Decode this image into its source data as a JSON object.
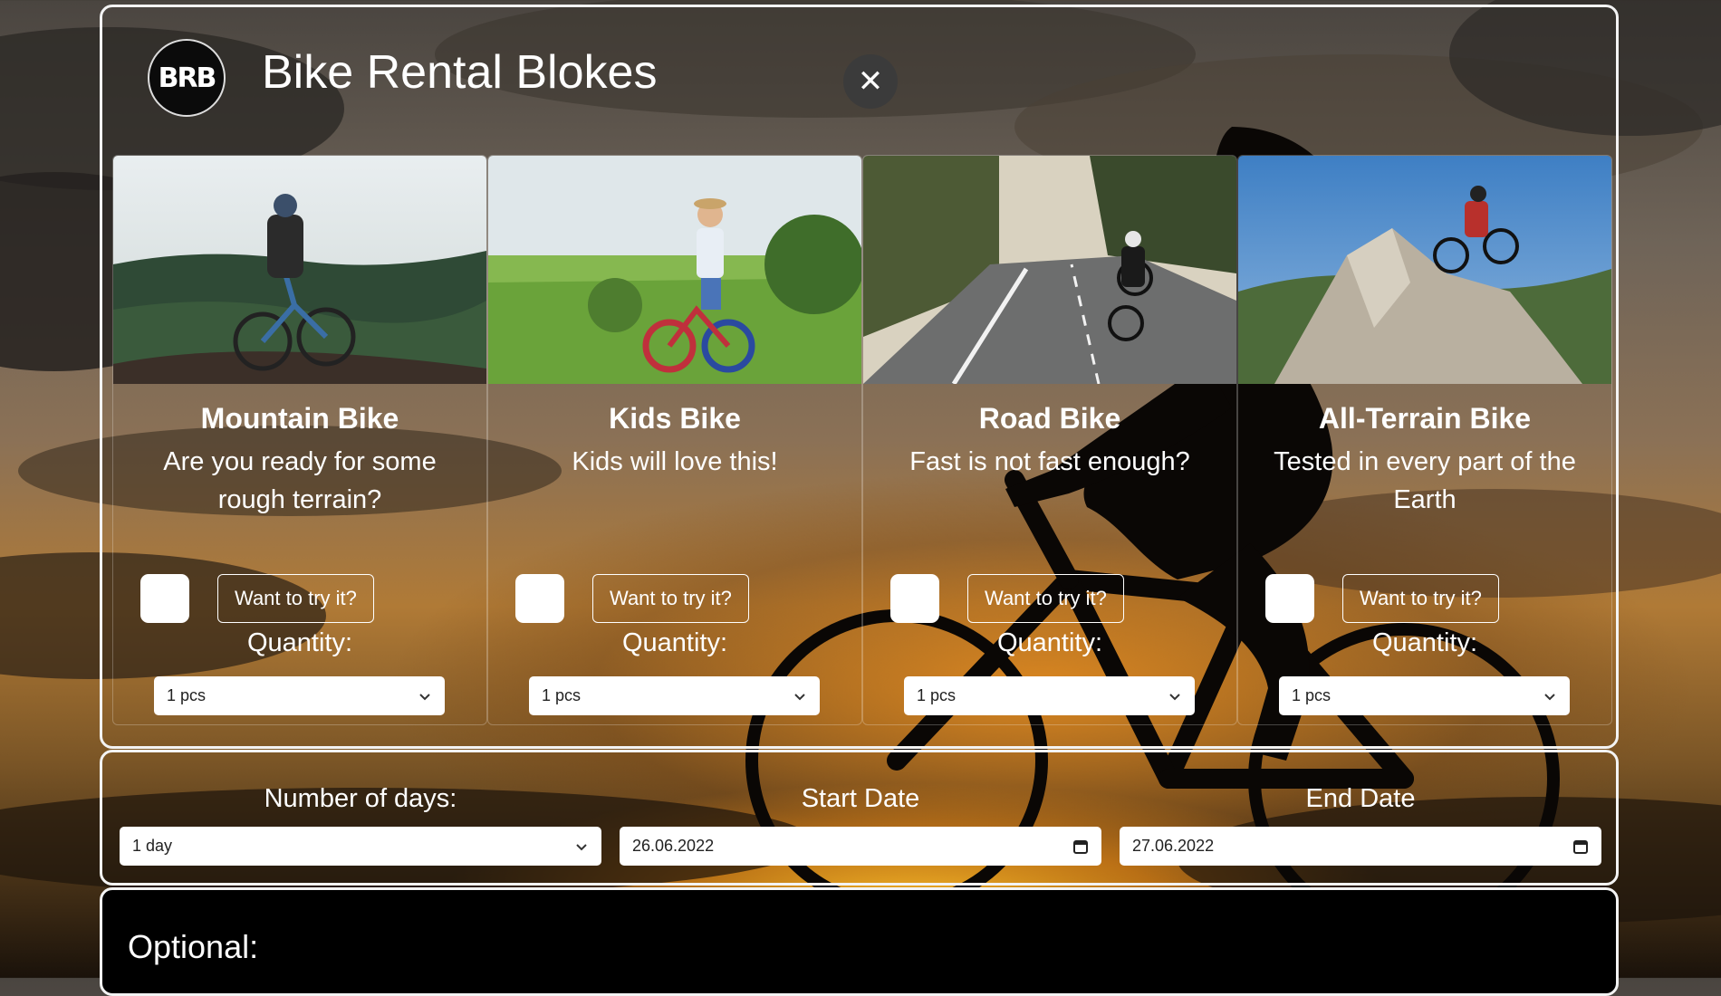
{
  "app": {
    "logo_text": "BRB",
    "title": "Bike Rental Blokes",
    "close_icon": "close-icon"
  },
  "bikes": [
    {
      "title": "Mountain Bike",
      "description": "Are you ready for some rough terrain?",
      "button": "Want to try it?",
      "quantity_label": "Quantity:",
      "quantity_value": "1 pcs"
    },
    {
      "title": "Kids Bike",
      "description": "Kids will love this!",
      "button": "Want to try it?",
      "quantity_label": "Quantity:",
      "quantity_value": "1 pcs"
    },
    {
      "title": "Road Bike",
      "description": "Fast is not fast enough?",
      "button": "Want to try it?",
      "quantity_label": "Quantity:",
      "quantity_value": "1 pcs"
    },
    {
      "title": "All-Terrain Bike",
      "description": "Tested in every part of the Earth",
      "button": "Want to try it?",
      "quantity_label": "Quantity:",
      "quantity_value": "1 pcs"
    }
  ],
  "booking": {
    "days_label": "Number of days:",
    "days_value": "1 day",
    "start_label": "Start Date",
    "start_value": "26.06.2022",
    "end_label": "End Date",
    "end_value": "27.06.2022"
  },
  "optional": {
    "title": "Optional:"
  },
  "colors": {
    "panel_border": "#f3f3f3",
    "close_button_bg": "#3b3b3b",
    "sunset_orange": "#e88a20"
  }
}
